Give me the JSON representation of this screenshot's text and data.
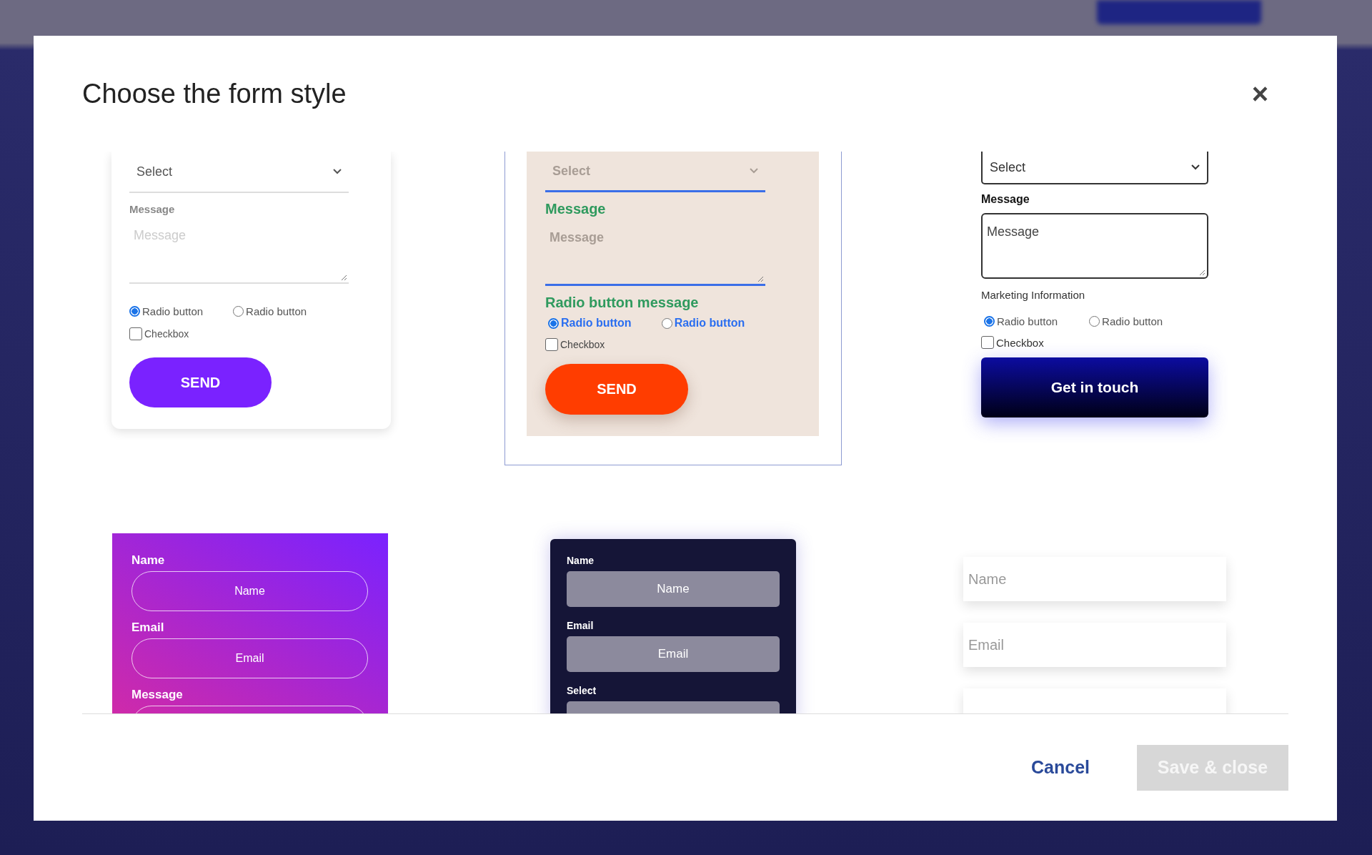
{
  "dialog": {
    "title": "Choose the form style",
    "close_label": "×"
  },
  "styles": [
    {
      "kind": "underline",
      "selected": false,
      "fields": [
        {
          "kind": "select",
          "value": "Select"
        },
        {
          "kind": "label",
          "text": "Message"
        },
        {
          "kind": "textarea",
          "placeholder": "Message"
        },
        {
          "kind": "radios",
          "options": [
            {
              "label": "Radio button",
              "selected": true
            },
            {
              "label": "Radio button",
              "selected": false
            }
          ]
        },
        {
          "kind": "checkbox",
          "label": "Checkbox",
          "checked": false
        },
        {
          "kind": "button",
          "label": "SEND"
        }
      ]
    },
    {
      "kind": "beige",
      "selected": true,
      "fields": [
        {
          "kind": "select",
          "value": "Select"
        },
        {
          "kind": "label",
          "text": "Message"
        },
        {
          "kind": "textarea",
          "placeholder": "Message"
        },
        {
          "kind": "label",
          "text": "Radio button message"
        },
        {
          "kind": "radios",
          "options": [
            {
              "label": "Radio button",
              "selected": true
            },
            {
              "label": "Radio button",
              "selected": false
            }
          ]
        },
        {
          "kind": "checkbox",
          "label": "Checkbox",
          "checked": false
        },
        {
          "kind": "button",
          "label": "SEND"
        }
      ]
    },
    {
      "kind": "outline",
      "selected": false,
      "fields": [
        {
          "kind": "select",
          "value": "Select"
        },
        {
          "kind": "label",
          "text": "Message"
        },
        {
          "kind": "textarea",
          "placeholder": "Message"
        },
        {
          "kind": "note",
          "text": "Marketing Information"
        },
        {
          "kind": "radios",
          "options": [
            {
              "label": "Radio button",
              "selected": true
            },
            {
              "label": "Radio button",
              "selected": false
            }
          ]
        },
        {
          "kind": "checkbox",
          "label": "Checkbox",
          "checked": false
        },
        {
          "kind": "button",
          "label": "Get in touch"
        }
      ]
    },
    {
      "kind": "gradient",
      "selected": false,
      "fields": [
        {
          "kind": "label",
          "text": "Name"
        },
        {
          "kind": "input",
          "placeholder": "Name"
        },
        {
          "kind": "label",
          "text": "Email"
        },
        {
          "kind": "input",
          "placeholder": "Email"
        },
        {
          "kind": "label",
          "text": "Message"
        },
        {
          "kind": "input"
        }
      ]
    },
    {
      "kind": "dark",
      "selected": false,
      "fields": [
        {
          "kind": "label",
          "text": "Name"
        },
        {
          "kind": "input",
          "placeholder": "Name"
        },
        {
          "kind": "label",
          "text": "Email"
        },
        {
          "kind": "input",
          "placeholder": "Email"
        },
        {
          "kind": "label",
          "text": "Select"
        },
        {
          "kind": "input"
        }
      ]
    },
    {
      "kind": "shadow",
      "selected": false,
      "fields": [
        {
          "kind": "input",
          "placeholder": "Name"
        },
        {
          "kind": "input",
          "placeholder": "Email"
        },
        {
          "kind": "input"
        }
      ]
    }
  ],
  "footer": {
    "buttons": [
      {
        "kind": "link",
        "label": "Cancel",
        "disabled": false
      },
      {
        "kind": "primary",
        "label": "Save & close",
        "disabled": true
      }
    ]
  }
}
